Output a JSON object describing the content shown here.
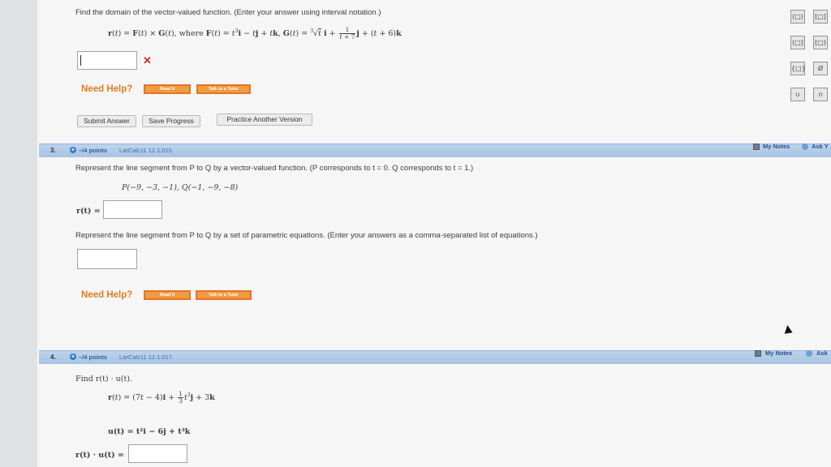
{
  "q2": {
    "prompt": "Find the domain of the vector-valued function. (Enter your answer using interval notation.)",
    "need_help": "Need Help?",
    "read_it": "Read It",
    "talk_tutor": "Talk to a Tutor",
    "submit": "Submit Answer",
    "save": "Save Progress",
    "practice": "Practice Another Version"
  },
  "symbols": [
    "(□)",
    "[□]",
    "(□]",
    "[□)",
    "{□}",
    "Ø",
    "∪",
    "∩"
  ],
  "q3": {
    "number": "3.",
    "points": "–/4 points",
    "source": "LarCalc11 12.1.015.",
    "my_notes": "My Notes",
    "ask": "Ask Y",
    "prompt1": "Represent the line segment from P to Q by a vector-valued function. (P corresponds to t = 0. Q corresponds to t = 1.)",
    "points_given": "P(−9, −3, −1), Q(−1, −9, −8)",
    "r_label": "r(t) =",
    "prompt2": "Represent the line segment from P to Q by a set of parametric equations. (Enter your answers as a comma-separated list of equations.)",
    "need_help": "Need Help?",
    "read_it": "Read It",
    "talk_tutor": "Talk to a Tutor"
  },
  "q4": {
    "number": "4.",
    "points": "–/4 points",
    "source": "LarCalc11 12.1.017.",
    "my_notes": "My Notes",
    "ask": "Ask",
    "prompt": "Find r(t) · u(t).",
    "u_def": "u(t) = t²i − 6j + t³k",
    "answer_label": "r(t) · u(t) ="
  }
}
